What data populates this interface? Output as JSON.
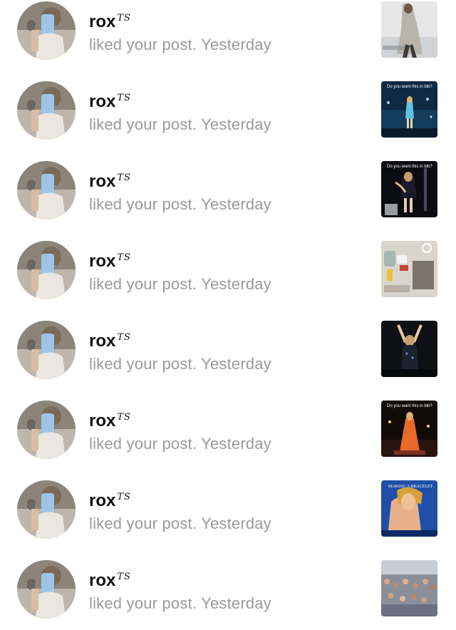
{
  "notifications": [
    {
      "username": "rox",
      "suffix": "TS",
      "action": "liked your post.",
      "time": "Yesterday",
      "thumbnail_icon": "fashion-photo-thumbnail",
      "thumb_caption": ""
    },
    {
      "username": "rox",
      "suffix": "TS",
      "action": "liked your post.",
      "time": "Yesterday",
      "thumbnail_icon": "concert-photo-thumbnail",
      "thumb_caption": "Do you want this in bib?"
    },
    {
      "username": "rox",
      "suffix": "TS",
      "action": "liked your post.",
      "time": "Yesterday",
      "thumbnail_icon": "concert-photo-thumbnail",
      "thumb_caption": "Do you want this in bib?"
    },
    {
      "username": "rox",
      "suffix": "TS",
      "action": "liked your post.",
      "time": "Yesterday",
      "thumbnail_icon": "products-photo-thumbnail",
      "thumb_caption": ""
    },
    {
      "username": "rox",
      "suffix": "TS",
      "action": "liked your post.",
      "time": "Yesterday",
      "thumbnail_icon": "concert-photo-thumbnail",
      "thumb_caption": ""
    },
    {
      "username": "rox",
      "suffix": "TS",
      "action": "liked your post.",
      "time": "Yesterday",
      "thumbnail_icon": "stage-photo-thumbnail",
      "thumb_caption": "Do you want this in bib?"
    },
    {
      "username": "rox",
      "suffix": "TS",
      "action": "liked your post.",
      "time": "Yesterday",
      "thumbnail_icon": "magazine-photo-thumbnail",
      "thumb_caption": "MAKING A BRACELET"
    },
    {
      "username": "rox",
      "suffix": "TS",
      "action": "liked your post.",
      "time": "Yesterday",
      "thumbnail_icon": "crowd-photo-thumbnail",
      "thumb_caption": ""
    }
  ],
  "colors": {
    "username": "#111111",
    "secondary_text": "#9a9a9a",
    "background": "#ffffff"
  }
}
